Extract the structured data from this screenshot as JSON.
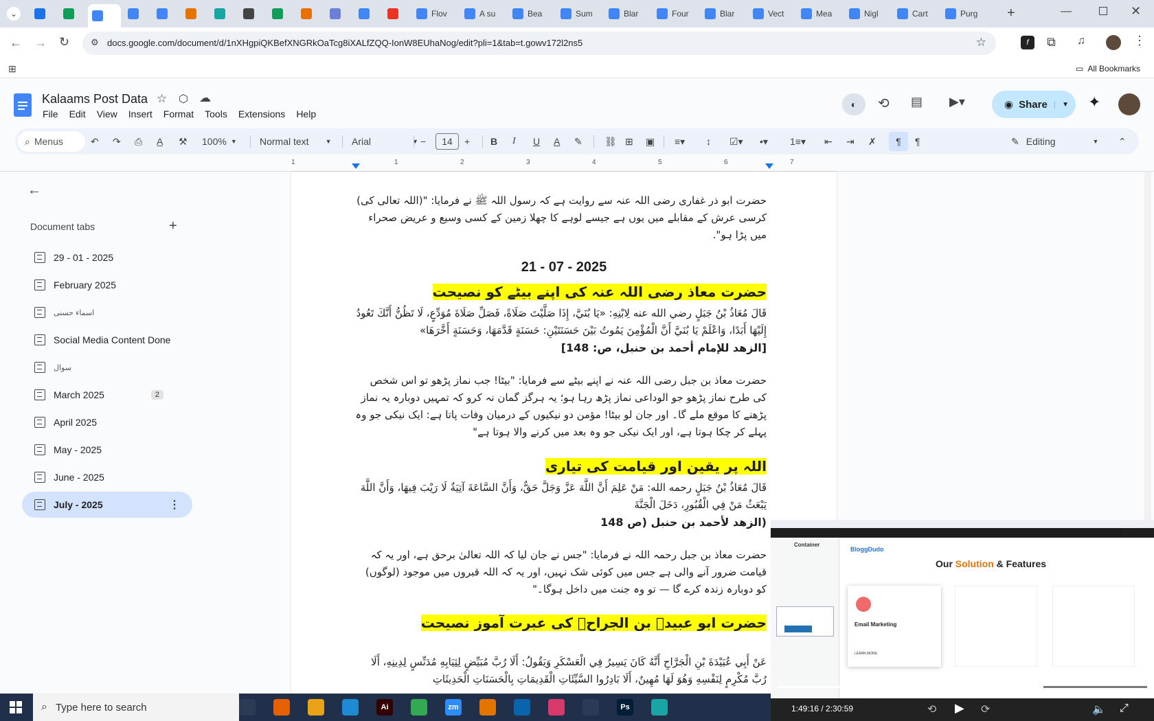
{
  "browser": {
    "tabs": [
      {
        "label": "",
        "color": "#1a73e8"
      },
      {
        "label": "",
        "color": "#0f9d58"
      },
      {
        "label": "",
        "color": "#4285f4",
        "active": true
      },
      {
        "label": "",
        "color": "#4285f4"
      },
      {
        "label": "",
        "color": "#4285f4"
      },
      {
        "label": "",
        "color": "#e37400"
      },
      {
        "label": "",
        "color": "#1aa5a5"
      },
      {
        "label": "",
        "color": "#444444"
      },
      {
        "label": "",
        "color": "#0f9d58"
      },
      {
        "label": "",
        "color": "#e8710a"
      },
      {
        "label": "",
        "color": "#6b7fd7"
      },
      {
        "label": "",
        "color": "#4285f4"
      },
      {
        "label": "",
        "color": "#ea3323"
      },
      {
        "label": "Flov",
        "color": "#4285f4"
      },
      {
        "label": "A su",
        "color": "#4285f4"
      },
      {
        "label": "Bea",
        "color": "#4285f4"
      },
      {
        "label": "Sum",
        "color": "#4285f4"
      },
      {
        "label": "Blar",
        "color": "#4285f4"
      },
      {
        "label": "Four",
        "color": "#4285f4"
      },
      {
        "label": "Blar",
        "color": "#4285f4"
      },
      {
        "label": "Vect",
        "color": "#4285f4"
      },
      {
        "label": "Mea",
        "color": "#4285f4"
      },
      {
        "label": "Nigl",
        "color": "#4285f4"
      },
      {
        "label": "Cart",
        "color": "#4285f4"
      },
      {
        "label": "Purg",
        "color": "#4285f4"
      }
    ],
    "url": "docs.google.com/document/d/1nXHgpiQKBefXNGRkOaTcg8iXALfZQQ-IonW8EUhaNog/edit?pli=1&tab=t.gowv172l2ns5",
    "all_bookmarks": "All Bookmarks"
  },
  "doc": {
    "title": "Kalaams Post Data",
    "menus": [
      "File",
      "Edit",
      "View",
      "Insert",
      "Format",
      "Tools",
      "Extensions",
      "Help"
    ],
    "share_label": "Share",
    "accent": "#c2e7ff"
  },
  "toolbar": {
    "search": "Menus",
    "zoom": "100%",
    "style": "Normal text",
    "font": "Arial",
    "size": "14",
    "mode": "Editing"
  },
  "ruler": [
    "1",
    "1",
    "2",
    "3",
    "4",
    "5",
    "6",
    "7"
  ],
  "sidebar": {
    "title": "Document tabs",
    "items": [
      {
        "label": "29 - 01 - 2025"
      },
      {
        "label": "February 2025"
      },
      {
        "label": "اسماء حسنی"
      },
      {
        "label": "Social Media Content Done"
      },
      {
        "label": "سوال"
      },
      {
        "label": "March 2025",
        "badge": "2"
      },
      {
        "label": "April 2025"
      },
      {
        "label": "May - 2025"
      },
      {
        "label": "June - 2025"
      },
      {
        "label": "July - 2025",
        "active": true
      }
    ]
  },
  "content": {
    "p1": "حضرت ابو ذر غفاری رضی اللہ عنہ سے روایت ہے کہ رسول اللہ ﷺ نے فرمایا: \"(اللہ تعالی کی) کرسی عرش کے مقابلے میں یوں ہے جیسے لوہے کا چھلا زمین کے کسی وسیع و عریض صحراء میں پڑا ہو\".",
    "date": "21 - 07 - 2025",
    "h1": "حضرت معاذ رضی اللہ عنہ کی اپنے بیٹے کو نصیحت",
    "a1": "قَالَ مُعَاذُ بْنُ جَبَلٍ رضي الله عنه لِابْنِهِ: «يَا بُنَيَّ، إِذَا صَلَّيْتَ صَلَاةً، فَصَلِّ صَلَاةَ مُوَدِّعٍ، لَا تَظُنُّ أَنَّكَ تَعُودُ إِلَيْهَا أَبَدًا، وَاعْلَمْ يَا بُنَيَّ أَنَّ الْمُؤْمِنَ يَمُوتُ بَيْنَ حَسَنَتَيْنِ: حَسَنَةٍ قَدَّمَهَا، وَحَسَنَةٍ أَخَّرَهَا»",
    "r1": "[الزهد للإمام أحمد بن حنبل، ص: 148]",
    "u1": "حضرت معاذ بن جبل رضی اللہ عنہ نے اپنے بیٹے سے فرمایا: \"بیٹا! جب نماز پڑھو تو اس شخص کی طرح نماز پڑھو جو الوداعی نماز پڑھ رہا ہو؛ یہ ہرگز گمان نہ کرو کہ تمہیں دوبارہ یہ نماز پڑھنے کا موقع ملے گا۔ اور جان لو بیٹا! مؤمن دو نیکیوں کے درمیان وفات پاتا ہے: ایک نیکی جو وہ پہلے کر چکا ہوتا ہے، اور ایک نیکی جو وہ بعد میں کرنے والا ہوتا ہے\"",
    "h2": "اللہ پر یقین اور قیامت کی تیاری",
    "a2": "قَالَ مُعَاذُ بْنُ جَبَلٍ رحمه الله: مَنْ عَلِمَ أَنَّ اللَّهَ عَزَّ وَجَلَّ حَقٌّ، وَأَنَّ السَّاعَةَ آتِيَةٌ لَا رَيْبَ فِيهَا، وَأَنَّ اللَّهَ يَبْعَثُ مَنْ فِي الْقُبُورِ، دَخَلَ الْجَنَّةَ",
    "r2": "(الزهد لأحمد بن حنبل (ص 148",
    "u2": "حضرت معاذ بن جبل رحمہ اللہ نے فرمایا: \"جس نے جان لیا کہ اللہ تعالیٰ برحق ہے، اور یہ کہ قیامت ضرور آنے والی ہے جس میں کوئی شک نہیں، اور یہ کہ اللہ قبروں میں موجود (لوگوں) کو دوبارہ زندہ کرے گا — تو وہ جنت میں داخل ہوگا۔\"",
    "h3": "حضرت ابو عبیدہ بن الجراحؓ کی عبرت آموز نصیحت",
    "a3": "عَنْ أَبِي عُبَيْدَةَ بْنِ الْجَرَّاحِ أَنَّهُ كَانَ يَسِيرُ فِي الْعَسْكَرِ وَيَقُولُ: أَلَا رُبَّ مُبَيِّضٍ لِثِيَابِهِ مُدَنِّسٍ لِدِينِهِ، أَلَا رُبَّ مُكْرِمٍ لِنَفْسِهِ وَهُوَ لَهَا مُهِينٌ، أَلَا بَادِرُوا السَّيِّئَاتِ الْقَدِيمَاتِ بِالْحَسَنَاتِ الْحَدِيثَاتِ"
  },
  "video": {
    "time": "1:49:16 / 2:30:59",
    "progress": 0.72,
    "site_name": "BloggDudo",
    "heading_a": "Our ",
    "heading_b": "Solution",
    "heading_c": " & Features",
    "card_title": "Email Marketing",
    "card_link": "LEARN MORE",
    "side_label": "Container"
  },
  "taskbar": {
    "search": "Type here to search",
    "apps": [
      {
        "name": "task-view",
        "color": "#2b3b55",
        "txt": ""
      },
      {
        "name": "firefox",
        "color": "#e66000",
        "txt": ""
      },
      {
        "name": "explorer",
        "color": "#e8a317",
        "txt": ""
      },
      {
        "name": "vscode",
        "color": "#1f8ad2",
        "txt": ""
      },
      {
        "name": "illustrator",
        "color": "#330000",
        "txt": "Ai"
      },
      {
        "name": "chrome",
        "color": "#34a853",
        "txt": ""
      },
      {
        "name": "zoom",
        "color": "#2d8cff",
        "txt": "zm"
      },
      {
        "name": "app-orange",
        "color": "#e37400",
        "txt": ""
      },
      {
        "name": "outlook",
        "color": "#0a64ad",
        "txt": ""
      },
      {
        "name": "app-pink",
        "color": "#d8396c",
        "txt": ""
      },
      {
        "name": "pen-app",
        "color": "#2b3b55",
        "txt": ""
      },
      {
        "name": "photoshop",
        "color": "#001e36",
        "txt": "Ps"
      },
      {
        "name": "app-teal",
        "color": "#1aa5a5",
        "txt": ""
      }
    ]
  }
}
